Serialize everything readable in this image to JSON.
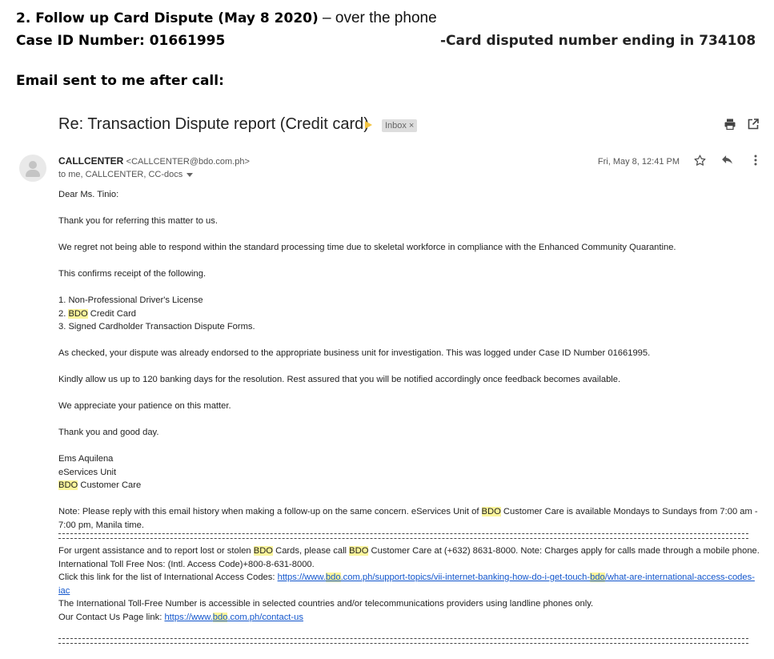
{
  "document": {
    "heading_bold": "2. Follow up Card Dispute (May 8 2020)",
    "heading_rest": " – over the phone",
    "case_line": "Case ID Number: 01661995",
    "card_line": "-Card disputed number ending in 734108",
    "email_sent": "Email sent to me after call:"
  },
  "email": {
    "subject": "Re: Transaction Dispute report (Credit card)",
    "label": "Inbox",
    "label_close": "×",
    "sender_name": "CALLCENTER",
    "sender_address": "<CALLCENTER@bdo.com.ph>",
    "recipients": "to me, CALLCENTER, CC-docs",
    "date": "Fri, May 8, 12:41 PM",
    "icons": [
      "print-icon",
      "open-in-new-window-icon",
      "star-icon",
      "reply-icon",
      "more-options-icon",
      "avatar-icon",
      "important-marker-icon"
    ],
    "colors": {
      "highlight": "#fbf59b",
      "link": "#1155cc",
      "marker": "#f4c542"
    }
  },
  "body": {
    "greeting": "Dear Ms. Tinio:",
    "p1": "Thank you for referring this matter to us.",
    "p2": "We regret not being able to respond within the standard processing time due to skeletal workforce in compliance with the Enhanced Community Quarantine.",
    "p3": "This confirms receipt of the following.",
    "item1": "1. Non-Professional Driver's License",
    "item2_pre": "2. ",
    "item2_bdo": "BDO",
    "item2_post": " Credit Card",
    "item3": "3. Signed Cardholder Transaction Dispute Forms.",
    "p4": "As checked, your dispute was already endorsed to the appropriate business unit for investigation. This was logged under Case ID Number 01661995.",
    "p5": "Kindly allow us up to 120 banking days for the resolution. Rest assured that you will be notified accordingly once feedback becomes available.",
    "p6": "We appreciate your patience on this matter.",
    "p7": "Thank you and good day.",
    "sig_name": "Ems Aquilena",
    "sig_unit": "eServices Unit",
    "sig_bdo": "BDO",
    "sig_rest": " Customer Care",
    "note_a": "Note: Please reply with this email history when making a follow-up on the same concern. eServices Unit of ",
    "note_bdo": "BDO",
    "note_b": " Customer Care is available Mondays to Sundays from 7:00 am - 7:00 pm, Manila time.",
    "urgent_a": "For urgent assistance and to report lost or stolen ",
    "urgent_bdo1": "BDO",
    "urgent_b": " Cards, please call ",
    "urgent_bdo2": "BDO",
    "urgent_c": " Customer Care at (+632) 8631-8000. Note: Charges apply for calls made through a mobile phone.",
    "tollfree": "International Toll Free Nos: (Intl. Access Code)+800-8-631-8000.",
    "link_intro": "Click this link for the list of International Access Codes: ",
    "link1_a": "https://www.",
    "link1_bdo": "bdo",
    "link1_b": ".com.ph/support-topics/vii-internet-banking-how-do-i-get-touch-",
    "link1_bdo2": "bdo",
    "link1_c": "/what-are-international-access-codes-iac",
    "intl_note": "The International Toll-Free Number is accessible in selected countries and/or telecommunications providers using landline phones only.",
    "contact_intro": "Our Contact Us Page link: ",
    "link2_a": "https://www.",
    "link2_bdo": "bdo",
    "link2_b": ".com.ph/contact-us"
  }
}
